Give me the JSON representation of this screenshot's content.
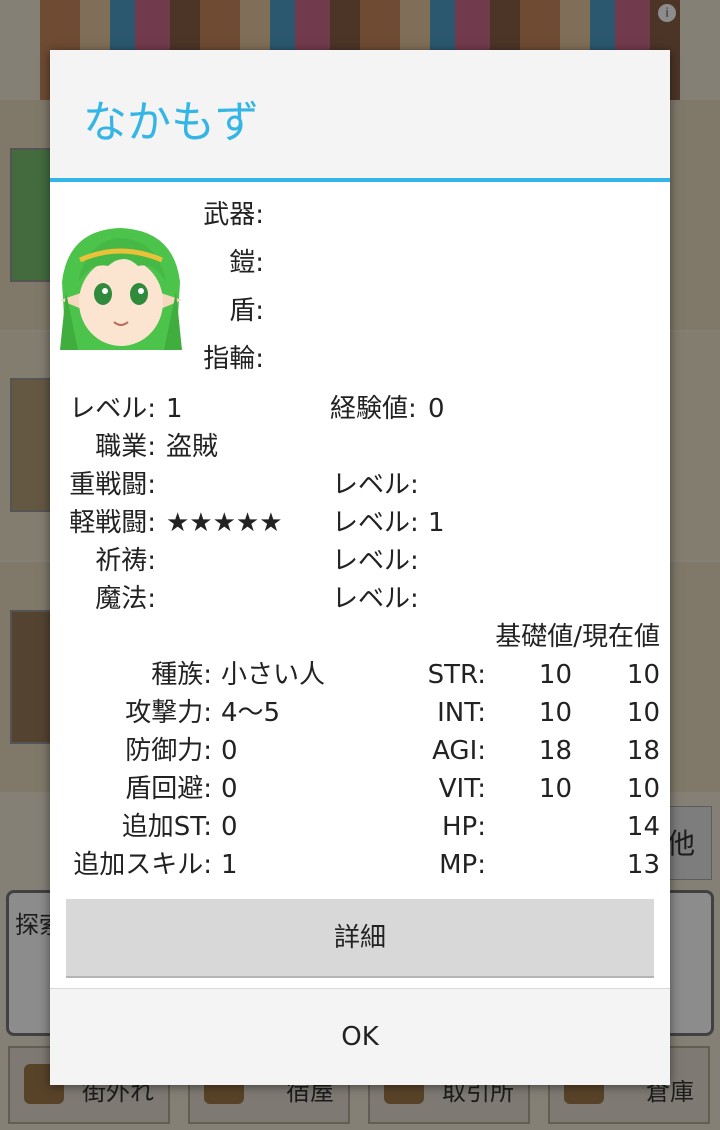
{
  "background": {
    "misc_button": "他",
    "explore_label": "探索",
    "nav": [
      "街外れ",
      "宿屋",
      "取引所",
      "倉庫"
    ]
  },
  "dialog": {
    "title": "なかもず",
    "equipment": {
      "weapon_label": "武器:",
      "armor_label": "鎧:",
      "shield_label": "盾:",
      "ring_label": "指輪:"
    },
    "level_label": "レベル:",
    "level_value": "1",
    "exp_label": "経験値:",
    "exp_value": "0",
    "job_label": "職業:",
    "job_value": "盗賊",
    "skills": [
      {
        "label": "重戦闘:",
        "stars": "",
        "level_label": "レベル:",
        "level": ""
      },
      {
        "label": "軽戦闘:",
        "stars": "★★★★★",
        "level_label": "レベル:",
        "level": "1"
      },
      {
        "label": "祈祷:",
        "stars": "",
        "level_label": "レベル:",
        "level": ""
      },
      {
        "label": "魔法:",
        "stars": "",
        "level_label": "レベル:",
        "level": ""
      }
    ],
    "stats_header": "基礎値/現在値",
    "attributes": [
      {
        "label": "種族:",
        "value": "小さい人"
      },
      {
        "label": "攻撃力:",
        "value": "4〜5"
      },
      {
        "label": "防御力:",
        "value": "0"
      },
      {
        "label": "盾回避:",
        "value": "0"
      },
      {
        "label": "追加ST:",
        "value": "0"
      },
      {
        "label": "追加スキル:",
        "value": "1"
      }
    ],
    "stats": [
      {
        "label": "STR:",
        "base": "10",
        "current": "10"
      },
      {
        "label": "INT:",
        "base": "10",
        "current": "10"
      },
      {
        "label": "AGI:",
        "base": "18",
        "current": "18"
      },
      {
        "label": "VIT:",
        "base": "10",
        "current": "10"
      },
      {
        "label": "HP:",
        "base": "",
        "current": "14"
      },
      {
        "label": "MP:",
        "base": "",
        "current": "13"
      }
    ],
    "details_button": "詳細",
    "ok_button": "OK"
  },
  "colors": {
    "accent": "#33b5e5",
    "dialog_bg": "#ffffff",
    "header_bg": "#f4f4f4",
    "button_bg": "#d8d8d8"
  },
  "icons": {
    "avatar": "green-haired-elf-portrait"
  }
}
